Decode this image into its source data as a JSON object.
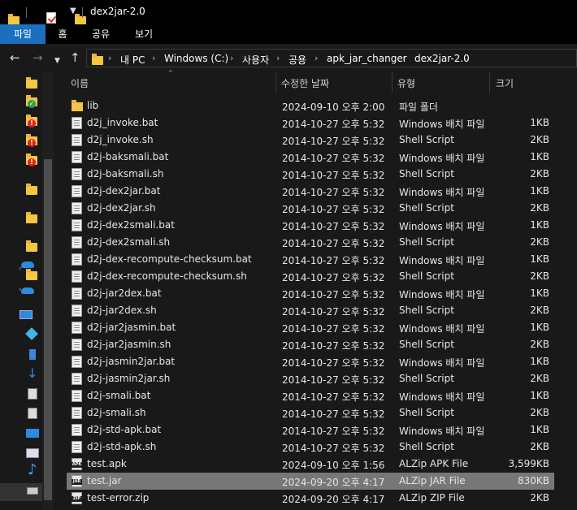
{
  "window": {
    "title": "dex2jar-2.0"
  },
  "ribbon": {
    "tabs": [
      {
        "label": "파일",
        "active": true
      },
      {
        "label": "홈",
        "active": false
      },
      {
        "label": "공유",
        "active": false
      },
      {
        "label": "보기",
        "active": false
      }
    ]
  },
  "address": {
    "crumbs": [
      "내 PC",
      "Windows (C:)",
      "사용자",
      "공용",
      "apk_jar_changer",
      "dex2jar-2.0"
    ]
  },
  "columns": {
    "name": "이름",
    "date": "수정한 날짜",
    "type": "유형",
    "size": "크기"
  },
  "files": [
    {
      "name": "lib",
      "date": "2024-09-10 오후 2:00",
      "type": "파일 폴더",
      "size": "",
      "icon": "folder-icon"
    },
    {
      "name": "d2j_invoke.bat",
      "date": "2014-10-27 오후 5:32",
      "type": "Windows 배치 파일",
      "size": "1KB",
      "icon": "batch-file-icon"
    },
    {
      "name": "d2j_invoke.sh",
      "date": "2014-10-27 오후 5:32",
      "type": "Shell Script",
      "size": "2KB",
      "icon": "script-file-icon"
    },
    {
      "name": "d2j-baksmali.bat",
      "date": "2014-10-27 오후 5:32",
      "type": "Windows 배치 파일",
      "size": "1KB",
      "icon": "batch-file-icon"
    },
    {
      "name": "d2j-baksmali.sh",
      "date": "2014-10-27 오후 5:32",
      "type": "Shell Script",
      "size": "2KB",
      "icon": "script-file-icon"
    },
    {
      "name": "d2j-dex2jar.bat",
      "date": "2014-10-27 오후 5:32",
      "type": "Windows 배치 파일",
      "size": "1KB",
      "icon": "batch-file-icon"
    },
    {
      "name": "d2j-dex2jar.sh",
      "date": "2014-10-27 오후 5:32",
      "type": "Shell Script",
      "size": "2KB",
      "icon": "script-file-icon"
    },
    {
      "name": "d2j-dex2smali.bat",
      "date": "2014-10-27 오후 5:32",
      "type": "Windows 배치 파일",
      "size": "1KB",
      "icon": "batch-file-icon"
    },
    {
      "name": "d2j-dex2smali.sh",
      "date": "2014-10-27 오후 5:32",
      "type": "Shell Script",
      "size": "2KB",
      "icon": "script-file-icon"
    },
    {
      "name": "d2j-dex-recompute-checksum.bat",
      "date": "2014-10-27 오후 5:32",
      "type": "Windows 배치 파일",
      "size": "1KB",
      "icon": "batch-file-icon"
    },
    {
      "name": "d2j-dex-recompute-checksum.sh",
      "date": "2014-10-27 오후 5:32",
      "type": "Shell Script",
      "size": "2KB",
      "icon": "script-file-icon"
    },
    {
      "name": "d2j-jar2dex.bat",
      "date": "2014-10-27 오후 5:32",
      "type": "Windows 배치 파일",
      "size": "1KB",
      "icon": "batch-file-icon"
    },
    {
      "name": "d2j-jar2dex.sh",
      "date": "2014-10-27 오후 5:32",
      "type": "Shell Script",
      "size": "2KB",
      "icon": "script-file-icon"
    },
    {
      "name": "d2j-jar2jasmin.bat",
      "date": "2014-10-27 오후 5:32",
      "type": "Windows 배치 파일",
      "size": "1KB",
      "icon": "batch-file-icon"
    },
    {
      "name": "d2j-jar2jasmin.sh",
      "date": "2014-10-27 오후 5:32",
      "type": "Shell Script",
      "size": "2KB",
      "icon": "script-file-icon"
    },
    {
      "name": "d2j-jasmin2jar.bat",
      "date": "2014-10-27 오후 5:32",
      "type": "Windows 배치 파일",
      "size": "1KB",
      "icon": "batch-file-icon"
    },
    {
      "name": "d2j-jasmin2jar.sh",
      "date": "2014-10-27 오후 5:32",
      "type": "Shell Script",
      "size": "2KB",
      "icon": "script-file-icon"
    },
    {
      "name": "d2j-smali.bat",
      "date": "2014-10-27 오후 5:32",
      "type": "Windows 배치 파일",
      "size": "1KB",
      "icon": "batch-file-icon"
    },
    {
      "name": "d2j-smali.sh",
      "date": "2014-10-27 오후 5:32",
      "type": "Shell Script",
      "size": "2KB",
      "icon": "script-file-icon"
    },
    {
      "name": "d2j-std-apk.bat",
      "date": "2014-10-27 오후 5:32",
      "type": "Windows 배치 파일",
      "size": "1KB",
      "icon": "batch-file-icon"
    },
    {
      "name": "d2j-std-apk.sh",
      "date": "2014-10-27 오후 5:32",
      "type": "Shell Script",
      "size": "2KB",
      "icon": "script-file-icon"
    },
    {
      "name": "test.apk",
      "date": "2024-09-10 오후 1:56",
      "type": "ALZip APK File",
      "size": "3,599KB",
      "icon": "apk-file-icon",
      "tag": "APK"
    },
    {
      "name": "test.jar",
      "date": "2024-09-20 오후 4:17",
      "type": "ALZip JAR File",
      "size": "830KB",
      "icon": "jar-file-icon",
      "tag": "JAR",
      "selected": true
    },
    {
      "name": "test-error.zip",
      "date": "2024-09-20 오후 4:17",
      "type": "ALZip ZIP File",
      "size": "2KB",
      "icon": "zip-file-icon",
      "tag": "ZIP"
    }
  ],
  "colors": {
    "background": "#191919",
    "ribbon_active": "#1a6fbf",
    "selected_row": "#777777",
    "folder": "#f5c543"
  }
}
